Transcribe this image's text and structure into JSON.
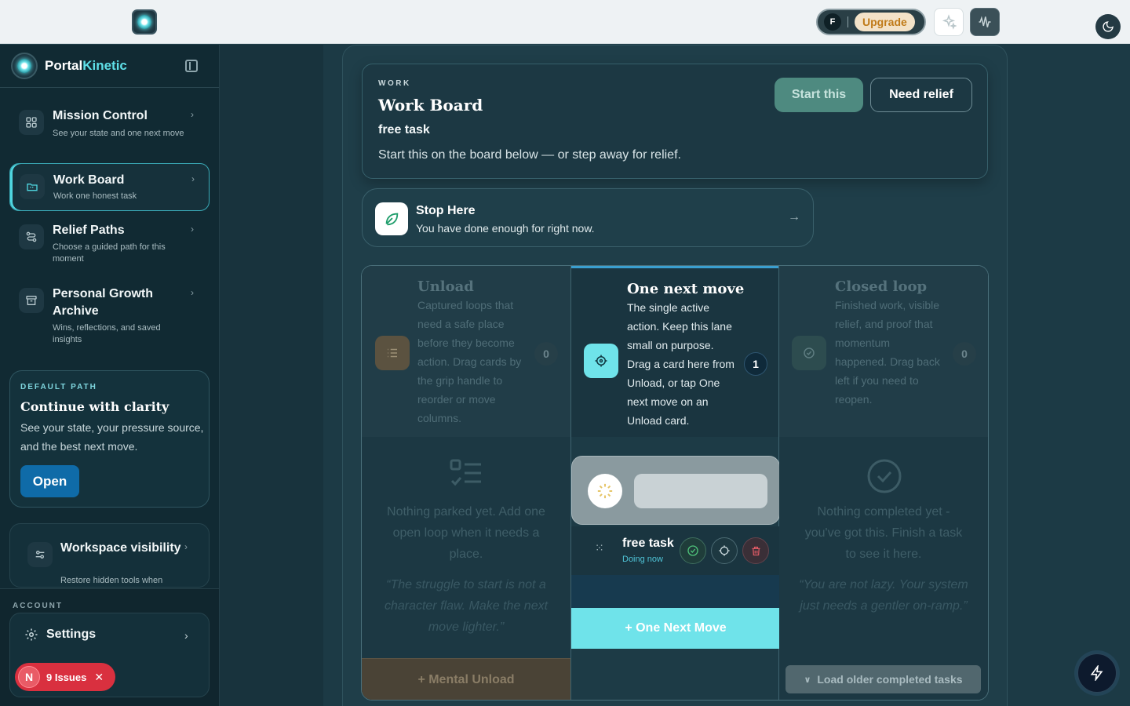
{
  "topbar": {
    "avatar_initial": "F",
    "upgrade_label": "Upgrade"
  },
  "sidebar": {
    "brand_first": "Portal",
    "brand_second": "Kinetic",
    "items": [
      {
        "title": "Mission Control",
        "subtitle": "See your state and one next move",
        "icon": "grid-icon"
      },
      {
        "title": "Work Board",
        "subtitle": "Work one honest task",
        "icon": "folder-icon",
        "active": true
      },
      {
        "title": "Relief Paths",
        "subtitle": "Choose a guided path for this moment",
        "icon": "paths-icon"
      },
      {
        "title": "Personal Growth Archive",
        "subtitle": "Wins, reflections, and saved insights",
        "icon": "archive-icon"
      }
    ],
    "default_path": {
      "label": "DEFAULT PATH",
      "title": "Continue with clarity",
      "description": "See your state, your pressure source, and the best next move.",
      "button": "Open"
    },
    "workspace": {
      "title": "Workspace visibility",
      "subtitle": "Restore hidden tools when"
    },
    "account_label": "ACCOUNT",
    "settings_label": "Settings",
    "issues": {
      "initial": "N",
      "label": "9 Issues"
    }
  },
  "header": {
    "eyebrow": "WORK",
    "title": "Work Board",
    "task": "free task",
    "description": "Start this on the board below — or step away for relief.",
    "start_label": "Start this",
    "relief_label": "Need relief"
  },
  "stop": {
    "title": "Stop Here",
    "subtitle": "You have done enough for right now."
  },
  "board": {
    "unload": {
      "title": "Unload",
      "description": "Captured loops that need a safe place before they become action. Drag cards by the grip handle to reorder or move columns.",
      "count": "0",
      "empty": "Nothing parked yet. Add one open loop when it needs a place.",
      "quote": "“The struggle to start is not a character flaw. Make the next move lighter.”",
      "button": "+ Mental Unload"
    },
    "next": {
      "title": "One next move",
      "description": "The single active action. Keep this lane small on purpose. Drag a card here from Unload, or tap One next move on an Unload card.",
      "count": "1",
      "task_name": "free task",
      "task_status": "Doing now",
      "button": "+ One Next Move"
    },
    "closed": {
      "title": "Closed loop",
      "description": "Finished work, visible relief, and proof that momentum happened. Drag back left if you need to reopen.",
      "count": "0",
      "empty": "Nothing completed yet - you've got this. Finish a task to see it here.",
      "quote": "“You are not lazy. Your system just needs a gentler on-ramp.”",
      "button": "Load older completed tasks"
    }
  },
  "colors": {
    "accent": "#6fe3ea",
    "danger": "#d9303f",
    "primary_button": "#0f6ba8"
  }
}
